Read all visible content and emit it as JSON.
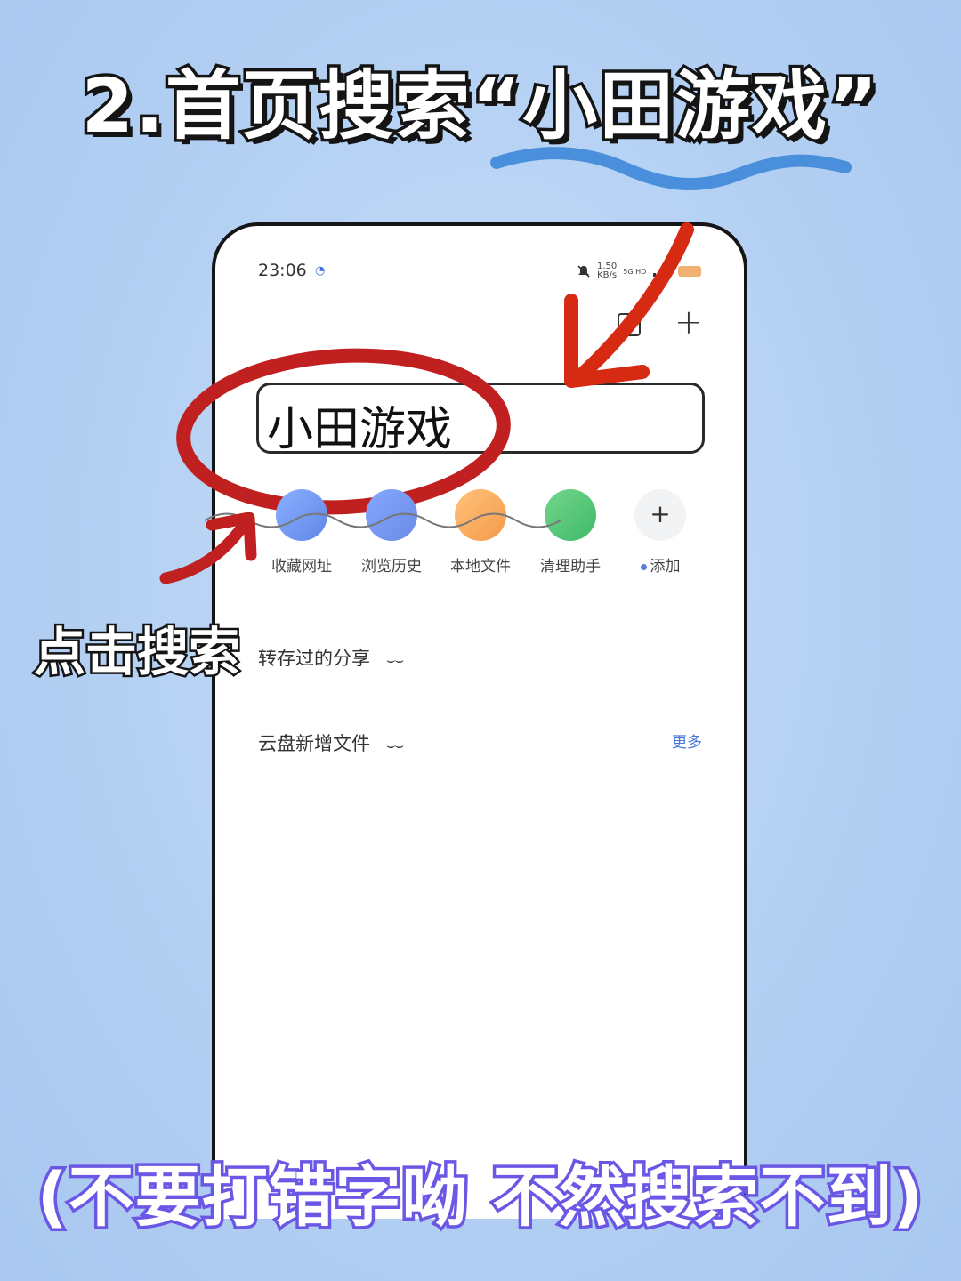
{
  "headline": "2.首页搜索“小田游戏”",
  "status": {
    "time": "23:06",
    "speed_value": "1.50",
    "speed_unit": "KB/s",
    "network": "5G HD"
  },
  "search": {
    "text": "小田游戏"
  },
  "shortcuts": [
    {
      "label": "收藏网址"
    },
    {
      "label": "浏览历史"
    },
    {
      "label": "本地文件"
    },
    {
      "label": "清理助手"
    },
    {
      "label": "添加"
    }
  ],
  "click_label": "点击搜索",
  "sections": {
    "saved_shares": "转存过的分享",
    "new_files": "云盘新增文件",
    "more": "更多"
  },
  "warning": "(不要打错字呦 不然搜索不到)",
  "colors": {
    "annotation_red": "#c0201f",
    "squiggle_blue": "#4a8fdc",
    "warning_stroke": "#6a57e6"
  }
}
